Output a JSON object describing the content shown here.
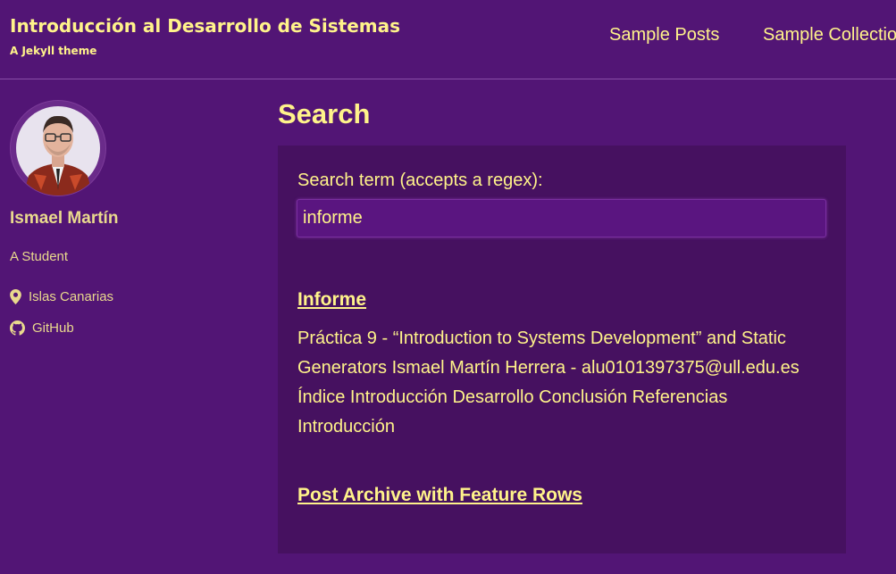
{
  "masthead": {
    "site_title": "Introducción al Desarrollo de Sistemas",
    "site_subtitle": "A Jekyll theme",
    "nav": [
      {
        "label": "Sample Posts"
      },
      {
        "label": "Sample Collections"
      }
    ]
  },
  "sidebar": {
    "avatar_icon": "avatar-photo",
    "author_name": "Ismael Martín",
    "author_bio": "A Student",
    "links": [
      {
        "label": "Islas Canarias",
        "icon": "map-marker-icon"
      },
      {
        "label": "GitHub",
        "icon": "github-icon"
      }
    ]
  },
  "main": {
    "page_title": "Search",
    "search_label": "Search term (accepts a regex):",
    "search_value": "informe",
    "results": [
      {
        "title": "Informe",
        "excerpt": "Práctica 9 - “Introduction to Systems Development” and Static Generators Ismael Martín Herrera - alu0101397375@ull.edu.es Índice Introducción Desarrollo Conclusión Referencias Introducción"
      },
      {
        "title": "Post Archive with Feature Rows",
        "excerpt": ""
      }
    ]
  },
  "colors": {
    "background": "#521575",
    "panel": "#461160",
    "accent_text": "#fff38a",
    "sidebar_text": "#e9d98d"
  }
}
